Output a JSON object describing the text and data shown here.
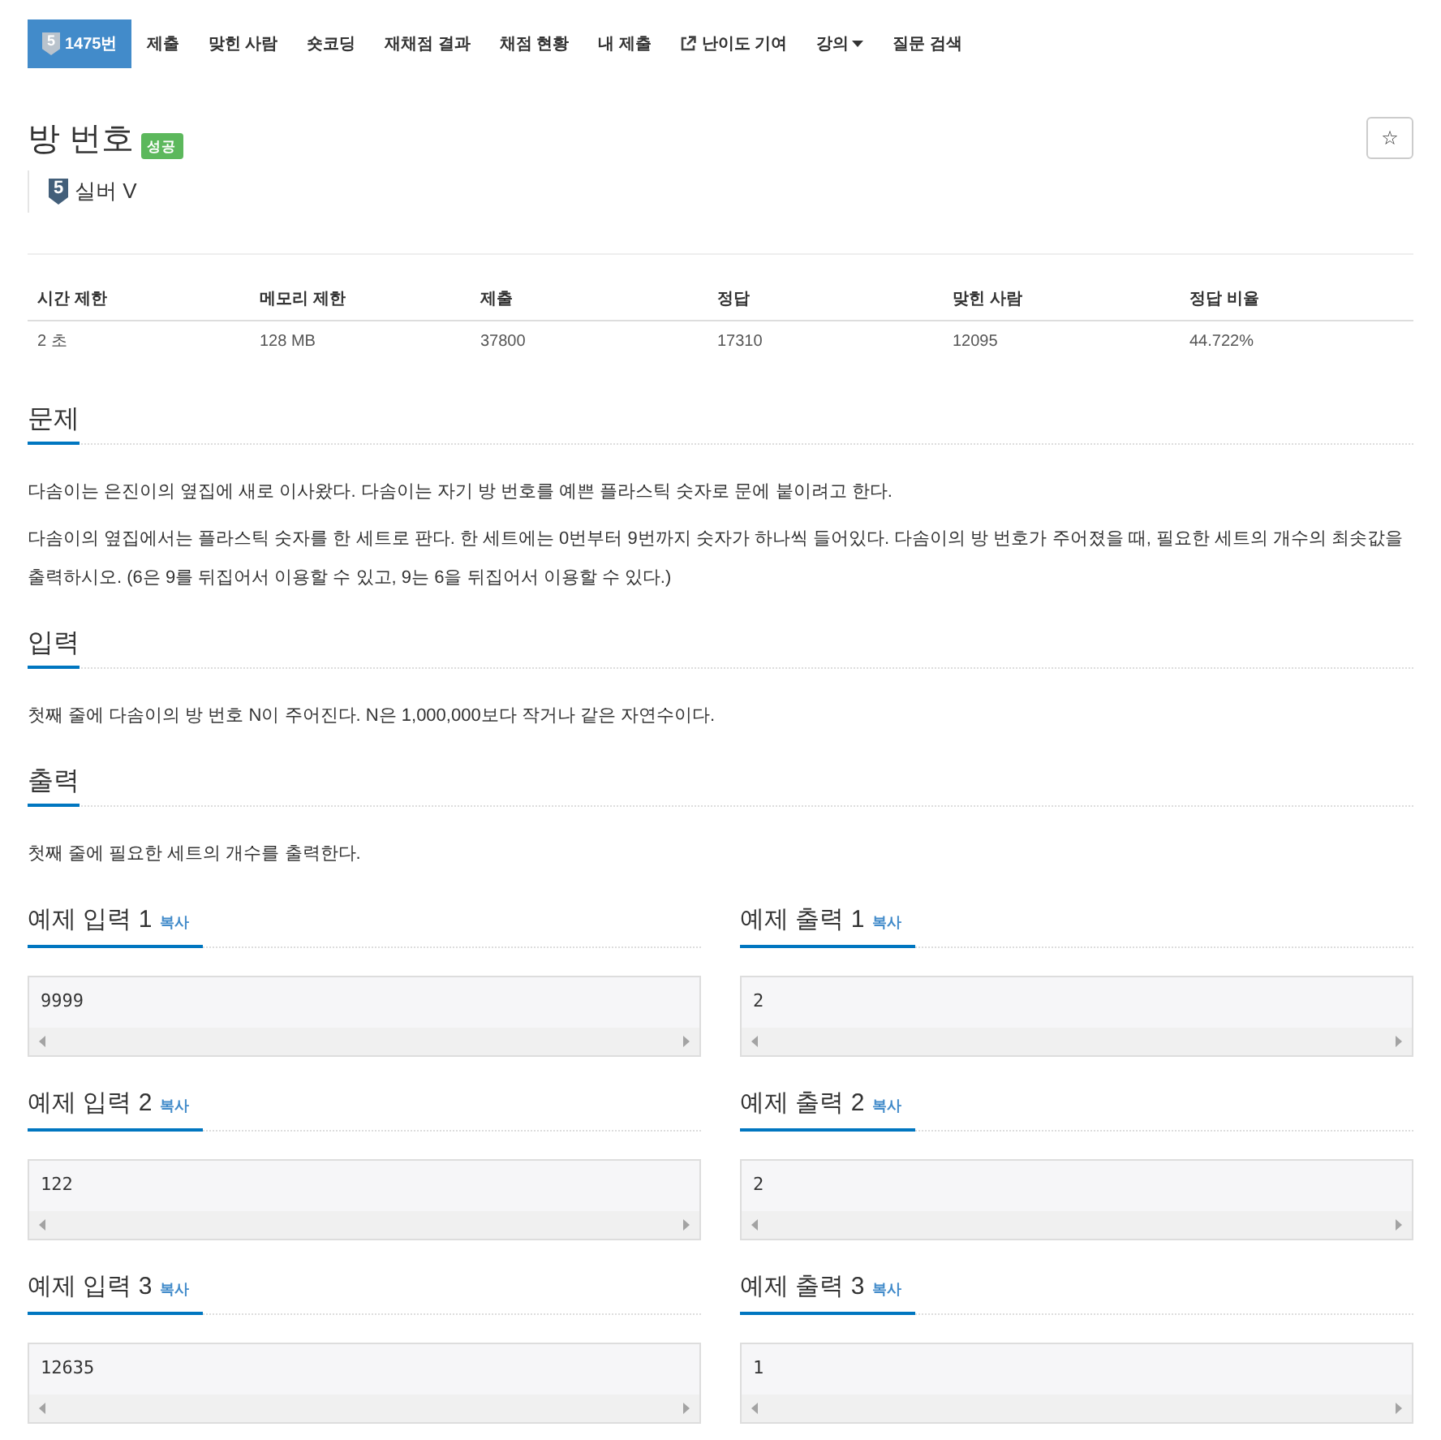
{
  "nav": {
    "tabs": [
      {
        "kind": "problem",
        "label": "1475번",
        "tier": "5",
        "selected": true
      },
      {
        "kind": "link",
        "label": "제출",
        "selected": false
      },
      {
        "kind": "link",
        "label": "맞힌 사람",
        "selected": false
      },
      {
        "kind": "link",
        "label": "숏코딩",
        "selected": false
      },
      {
        "kind": "link",
        "label": "재채점 결과",
        "selected": false
      },
      {
        "kind": "link",
        "label": "채점 현황",
        "selected": false
      },
      {
        "kind": "link",
        "label": "내 제출",
        "selected": false
      },
      {
        "kind": "external",
        "label": "난이도 기여",
        "selected": false
      },
      {
        "kind": "dropdown",
        "label": "강의",
        "selected": false
      },
      {
        "kind": "link",
        "label": "질문 검색",
        "selected": false
      }
    ]
  },
  "problem": {
    "title": "방 번호",
    "status": "성공",
    "favorite": "☆",
    "tier": {
      "number": "5",
      "name": "실버 V"
    }
  },
  "stats": {
    "columns": [
      "시간 제한",
      "메모리 제한",
      "제출",
      "정답",
      "맞힌 사람",
      "정답 비율"
    ],
    "rows": [
      [
        "2 초",
        "128 MB",
        "37800",
        "17310",
        "12095",
        "44.722%"
      ]
    ]
  },
  "sections": [
    {
      "heading": "문제",
      "paragraphs": [
        "다솜이는 은진이의 옆집에 새로 이사왔다. 다솜이는 자기 방 번호를 예쁜 플라스틱 숫자로 문에 붙이려고 한다.",
        "다솜이의 옆집에서는 플라스틱 숫자를 한 세트로 판다. 한 세트에는 0번부터 9번까지 숫자가 하나씩 들어있다. 다솜이의 방 번호가 주어졌을 때, 필요한 세트의 개수의 최솟값을 출력하시오. (6은 9를 뒤집어서 이용할 수 있고, 9는 6을 뒤집어서 이용할 수 있다.)"
      ]
    },
    {
      "heading": "입력",
      "paragraphs": [
        "첫째 줄에 다솜이의 방 번호 N이 주어진다. N은 1,000,000보다 작거나 같은 자연수이다."
      ]
    },
    {
      "heading": "출력",
      "paragraphs": [
        "첫째 줄에 필요한 세트의 개수를 출력한다."
      ]
    }
  ],
  "samples": [
    {
      "input": {
        "heading": "예제 입력 1",
        "copy": "복사",
        "content": "9999"
      },
      "output": {
        "heading": "예제 출력 1",
        "copy": "복사",
        "content": "2"
      }
    },
    {
      "input": {
        "heading": "예제 입력 2",
        "copy": "복사",
        "content": "122"
      },
      "output": {
        "heading": "예제 출력 2",
        "copy": "복사",
        "content": "2"
      }
    },
    {
      "input": {
        "heading": "예제 입력 3",
        "copy": "복사",
        "content": "12635"
      },
      "output": {
        "heading": "예제 출력 3",
        "copy": "복사",
        "content": "1"
      }
    }
  ]
}
